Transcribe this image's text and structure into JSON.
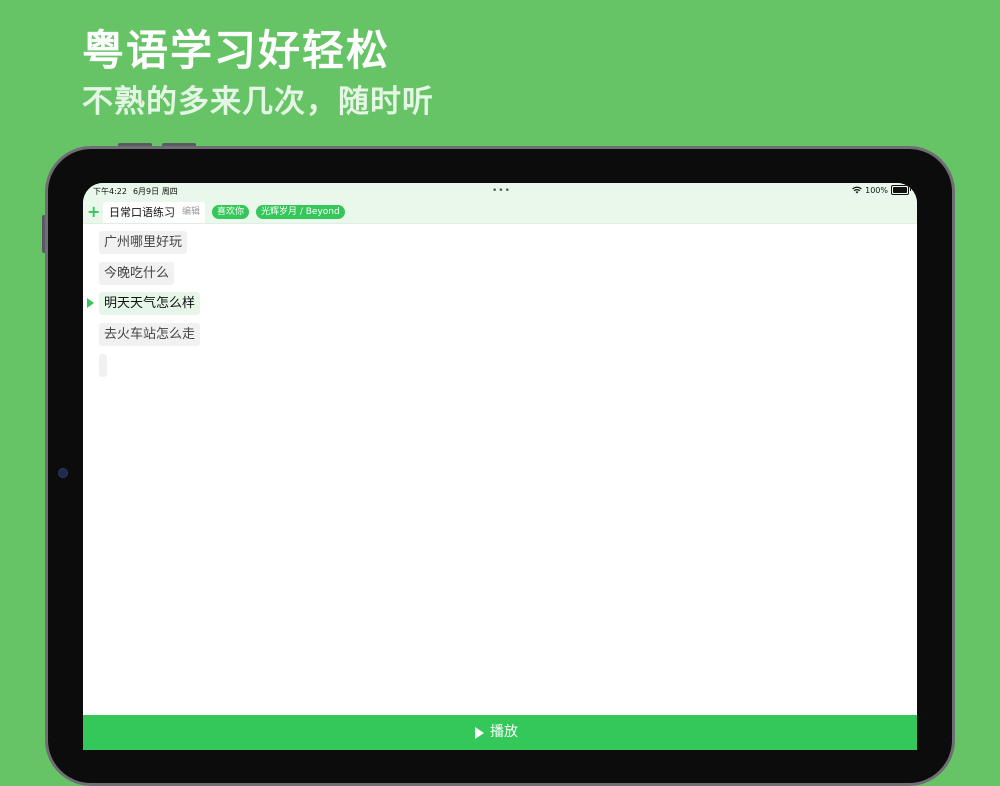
{
  "marketing": {
    "headline": "粤语学习好轻松",
    "subheadline": "不熟的多来几次，随时听"
  },
  "status_bar": {
    "time": "下午4:22",
    "date": "6月9日 周四",
    "dots": "•••",
    "battery": "100%"
  },
  "toolbar": {
    "add_icon": "+",
    "active_tab": {
      "label": "日常口语练习",
      "edit_label": "编辑"
    },
    "pills": [
      {
        "label": "喜欢你"
      },
      {
        "label": "光辉岁月 / Beyond"
      }
    ]
  },
  "phrases": [
    {
      "text": "广州哪里好玩",
      "active": false
    },
    {
      "text": "今晚吃什么",
      "active": false
    },
    {
      "text": "明天天气怎么样",
      "active": true
    },
    {
      "text": "去火车站怎么走",
      "active": false
    }
  ],
  "play_bar": {
    "label": "播放"
  },
  "colors": {
    "background": "#66c466",
    "accent": "#34c759",
    "toolbar_bg": "#eaf8ec"
  }
}
